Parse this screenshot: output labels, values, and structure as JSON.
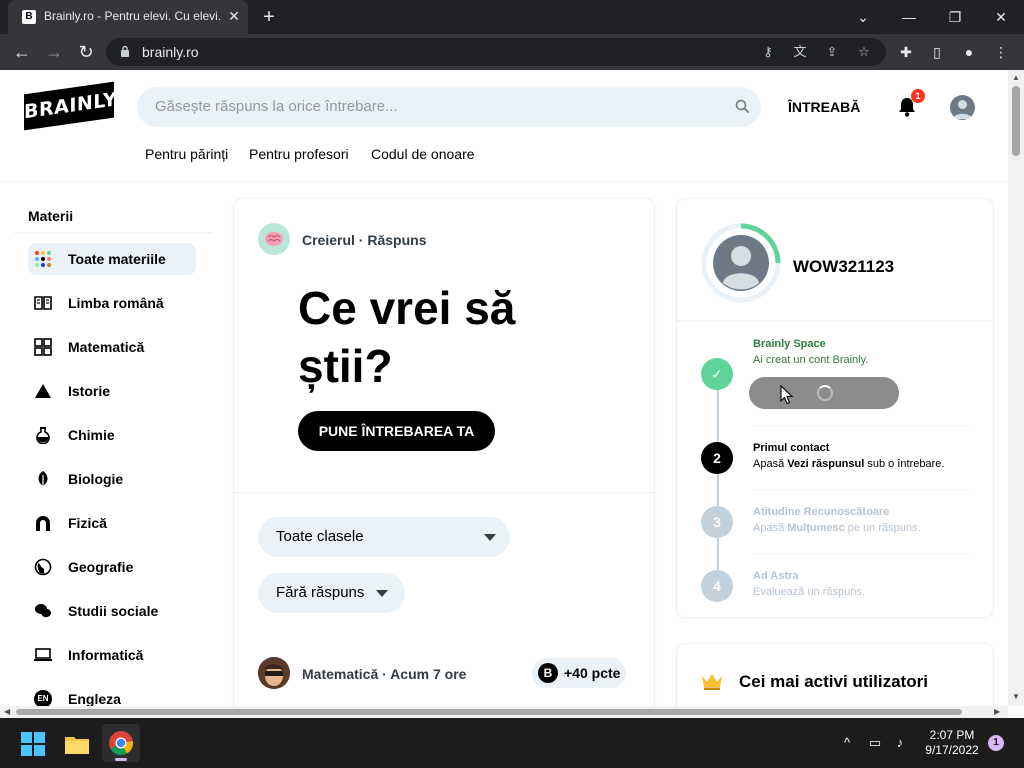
{
  "browser": {
    "tab_title": "Brainly.ro - Pentru elevi. Cu elevi.",
    "tab_favicon": "B",
    "tab_close": "✕",
    "new_tab": "+",
    "url": "brainly.ro",
    "minimize": "⌄",
    "restore": "—",
    "maximize": "❐",
    "close": "✕"
  },
  "header": {
    "logo": "BRAINLY",
    "search_placeholder": "Găsește răspuns la orice întrebare...",
    "ask_label": "ÎNTREABĂ",
    "notification_count": "1",
    "subnav": [
      "Pentru părinți",
      "Pentru profesori",
      "Codul de onoare"
    ]
  },
  "sidebar": {
    "title": "Materii",
    "items": [
      {
        "label": "Toate materiile",
        "icon": "all-subjects-icon"
      },
      {
        "label": "Limba română",
        "icon": "book-icon"
      },
      {
        "label": "Matematică",
        "icon": "calculator-icon"
      },
      {
        "label": "Istorie",
        "icon": "pyramid-icon"
      },
      {
        "label": "Chimie",
        "icon": "flask-icon"
      },
      {
        "label": "Biologie",
        "icon": "leaf-icon"
      },
      {
        "label": "Fizică",
        "icon": "magnet-icon"
      },
      {
        "label": "Geografie",
        "icon": "globe-icon"
      },
      {
        "label": "Studii sociale",
        "icon": "chat-icon"
      },
      {
        "label": "Informatică",
        "icon": "laptop-icon"
      },
      {
        "label": "Engleza",
        "icon": "language-icon"
      }
    ],
    "language_badge": "EN"
  },
  "main": {
    "brain_meta": "Creierul · Răspuns",
    "hero": "Ce vrei să știi?",
    "ask_button": "PUNE ÎNTREBAREA TA",
    "grade_filter": "Toate clasele",
    "answer_filter": "Fără răspuns",
    "question": {
      "meta": "Matematică · Acum 7 ore",
      "points": "+40 pcte",
      "points_icon": "B"
    }
  },
  "profile": {
    "username": "WOW321123",
    "steps": [
      {
        "number": "✓",
        "title": "Brainly Space",
        "desc": "Ai creat un cont Brainly.",
        "state": "done"
      },
      {
        "number": "2",
        "title": "Primul contact",
        "desc_prefix": "Apasă ",
        "desc_bold": "Vezi răspunsul",
        "desc_suffix": " sub o întrebare.",
        "state": "active"
      },
      {
        "number": "3",
        "title": "Atitudine Recunoscătoare",
        "desc_prefix": "Apasă ",
        "desc_bold": "Mulțumesc",
        "desc_suffix": " pe un răspuns.",
        "state": "locked"
      },
      {
        "number": "4",
        "title": "Ad Astra",
        "desc": "Evaluează un răspuns.",
        "state": "locked"
      }
    ]
  },
  "top_users": {
    "title": "Cei mai activi utilizatori"
  },
  "taskbar": {
    "time": "2:07 PM",
    "date": "9/17/2022",
    "notification_badge": "1",
    "tray_chevron": "^"
  },
  "colors": {
    "brand_green": "#2b7f3d",
    "success": "#60d399",
    "search_bg": "#ebf2f7",
    "badge_red": "#ff341a"
  }
}
